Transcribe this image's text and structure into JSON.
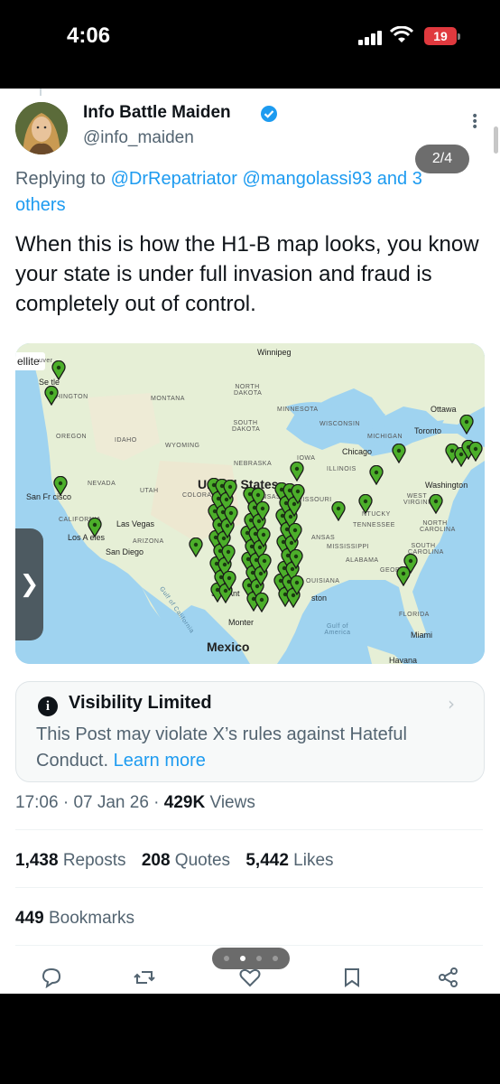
{
  "status_bar": {
    "time": "4:06",
    "battery": "19"
  },
  "post": {
    "author_name": "Info Battle Maiden",
    "author_handle": "@info_maiden",
    "pager": "2/4",
    "reply_prefix": "Replying to ",
    "reply_users": "@DrRepatriator @mangolassi93 and 3 others",
    "text": "When this is how the H1-B map looks, you know your state is under full invasion and fraud is completely out of control."
  },
  "map": {
    "control_label": "ellite",
    "colors": {
      "water": "#9fd3f0",
      "land": "#e8f0d8",
      "pin": "#4caf2a"
    },
    "labels": {
      "winnipeg": "Winnipeg",
      "north_dakota": "NORTH DAKOTA",
      "montana": "MONTANA",
      "minnesota": "MINNESOTA",
      "ottawa": "Ottawa",
      "south_dakota": "SOUTH DAKOTA",
      "wisconsin": "WISCONSIN",
      "toronto": "Toronto",
      "michigan": "MICHIGAN",
      "oregon": "OREGON",
      "idaho": "IDAHO",
      "wyoming": "WYOMING",
      "chicago": "Chicago",
      "iowa": "IOWA",
      "nebraska": "NEBRASKA",
      "illinois": "ILLINOIS",
      "nevada": "NEVADA",
      "utah": "UTAH",
      "united_states": "United States",
      "colorado": "COLORADO",
      "kansas": "ANSAS",
      "missouri": "MISSOURI",
      "washington": "Washington",
      "west_virginia": "WEST VIRGINIA",
      "san_francisco": "San Fr  cisco",
      "california": "CALIFORNIA",
      "las_vegas": "Las Vegas",
      "kentucky": "NTUCKY",
      "tennessee": "TENNESSEE",
      "north_carolina": "NORTH CAROLINA",
      "los_angeles": "Los A   eles",
      "arizona": "ARIZONA",
      "san_diego": "San Diego",
      "arkansas": "ANSAS",
      "mississippi": "MISSISSIPPI",
      "south_carolina": "SOUTH CAROLINA",
      "alabama": "ALABAMA",
      "georgia": "GEORG",
      "louisiana": "OUISIANA",
      "san_antonio": "San Ant",
      "houston": "ston",
      "florida": "FLORIDA",
      "monterrey": "Monter",
      "gulf_of_america": "Gulf of America",
      "mexico": "Mexico",
      "miami": "Miami",
      "havana": "Havana",
      "seattle": "Se  tle",
      "washington_state": "HINGTON",
      "vancouver": "uver",
      "gulf_of_california": "Gulf of California"
    }
  },
  "notice": {
    "title": "Visibility Limited",
    "text": "This Post may violate X’s rules against Hateful Conduct. ",
    "link": "Learn more"
  },
  "meta": {
    "time": "17:06",
    "date": "07 Jan 26",
    "views_count": "429K",
    "views_label": " Views"
  },
  "stats": {
    "reposts_count": "1,438",
    "reposts_label": "Reposts",
    "quotes_count": "208",
    "quotes_label": "Quotes",
    "likes_count": "5,442",
    "likes_label": "Likes",
    "bookmarks_count": "449",
    "bookmarks_label": "Bookmarks"
  }
}
